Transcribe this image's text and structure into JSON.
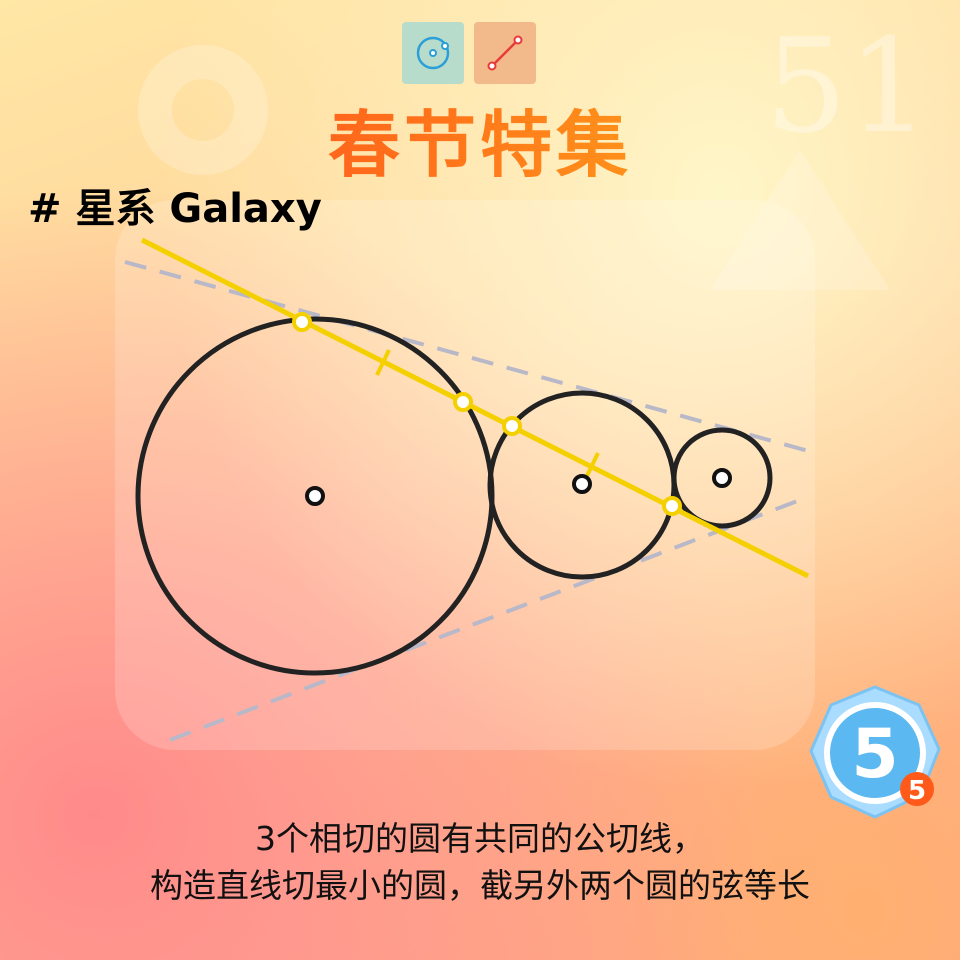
{
  "header": {
    "title": "春节特集",
    "level_name": "# 星系 Galaxy"
  },
  "background": {
    "number": "51"
  },
  "tools": [
    {
      "name": "circle-tool",
      "icon": "circle-with-center-icon",
      "color": "#b8dccb"
    },
    {
      "name": "line-segment-tool",
      "icon": "line-segment-icon",
      "color": "#f2b98a"
    }
  ],
  "badge": {
    "moves": "5",
    "count": "5",
    "color": "#5cb8f0"
  },
  "caption": {
    "line1": "3个相切的圆有共同的公切线，",
    "line2": "构造直线切最小的圆，截另外两个圆的弦等长"
  },
  "colors": {
    "construction_line": "#f5d000",
    "circle_stroke": "#222222",
    "tangent_dashes": "#b8b8c8"
  }
}
